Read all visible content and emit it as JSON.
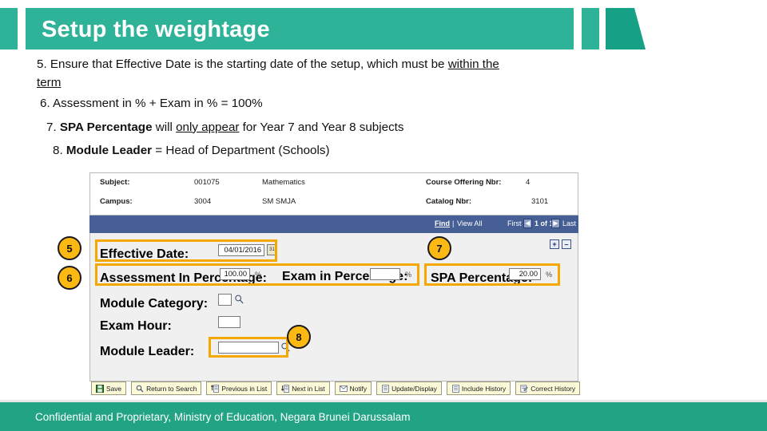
{
  "slide": {
    "title": "Setup the weightage",
    "accent_green": "#2eb398",
    "accent_green_dark": "#16a085",
    "footer_green": "#21a384",
    "highlight_orange": "#f5a800",
    "badge_yellow": "#fdb913",
    "nav_navy": "#465f95"
  },
  "bullets": [
    {
      "number": "5.",
      "parts": [
        {
          "text": " Ensure that Effective Date is the starting date of the setup, which must be ",
          "style": "normal"
        },
        {
          "text": "within the term",
          "style": "underline"
        }
      ],
      "plain": "5. Ensure that Effective Date is the starting date of the setup, which must be within the term"
    },
    {
      "number": "6.",
      "parts": [
        {
          "text": " Assessment in % + Exam in % = 100%",
          "style": "normal"
        }
      ],
      "plain": "6. Assessment in % + Exam in % = 100%"
    },
    {
      "number": "7.",
      "parts": [
        {
          "text": " SPA Percentage",
          "style": "bold"
        },
        {
          "text": " will ",
          "style": "normal"
        },
        {
          "text": "only appear",
          "style": "underline"
        },
        {
          "text": " for Year 7 and Year 8 subjects",
          "style": "normal"
        }
      ],
      "plain": "7. SPA Percentage will only appear for Year 7 and Year 8 subjects"
    },
    {
      "number": "8.",
      "parts": [
        {
          "text": " Module Leader",
          "style": "bold"
        },
        {
          "text": " = Head of Department (Schools)",
          "style": "normal"
        }
      ],
      "plain": "8. Module Leader = Head of Department (Schools)"
    }
  ],
  "bullet_text": {
    "b5_num": "5.",
    "b5_a": " Ensure that Effective Date is the starting date of the setup, which must be ",
    "b5_u": "within the",
    "b5_u2": "term",
    "b6_num": "6.",
    "b6_a": " Assessment in % + Exam in % = 100%",
    "b7_num": "7.",
    "b7_bold": " SPA Percentage",
    "b7_a": " will ",
    "b7_u": "only appear",
    "b7_b": " for Year 7 and Year 8 subjects",
    "b8_num": "8.",
    "b8_bold": " Module Leader",
    "b8_a": " = Head of Department (Schools)"
  },
  "app": {
    "header_fields": {
      "subject_label": "Subject:",
      "subject_code": "001075",
      "subject_name": "Mathematics",
      "course_offering_label": "Course Offering Nbr:",
      "course_offering_value": "4",
      "campus_label": "Campus:",
      "campus_code": "3004",
      "campus_name": "SM SMJA",
      "catalog_label": "Catalog Nbr:",
      "catalog_value": "3101"
    },
    "nav": {
      "find": "Find",
      "separator": "|",
      "view_all": "View All",
      "first": "First",
      "prev_arrow": "◀",
      "counter": "1 of 1",
      "next_arrow": "▶",
      "last": "Last"
    },
    "row_controls": {
      "add_row": "+",
      "delete_row": "–"
    },
    "form": {
      "effective_date_label": "Effective Date:",
      "effective_date_value": "04/01/2016",
      "calendar_icon": "calendar-icon",
      "assessment_label": "Assessment In Percentage:",
      "assessment_value": "100.00",
      "assessment_unit": "%",
      "exam_pct_label": "Exam in Percentage:",
      "exam_pct_value": "",
      "exam_pct_unit": "%",
      "spa_label": "SPA Percentage:",
      "spa_value": "20.00",
      "spa_unit": "%",
      "module_category_label": "Module Category:",
      "module_category_value": "",
      "exam_hour_label": "Exam Hour:",
      "exam_hour_value": "",
      "module_leader_label": "Module Leader:",
      "module_leader_value": ""
    },
    "toolbar": [
      {
        "label": "Save",
        "icon": "save-disk-icon"
      },
      {
        "label": "Return to Search",
        "icon": "magnifier-icon"
      },
      {
        "label": "Previous in List",
        "icon": "previous-list-icon"
      },
      {
        "label": "Next in List",
        "icon": "next-list-icon"
      },
      {
        "label": "Notify",
        "icon": "notify-envelope-icon"
      },
      {
        "label": "Update/Display",
        "icon": "update-display-icon"
      },
      {
        "label": "Include History",
        "icon": "include-history-icon"
      },
      {
        "label": "Correct History",
        "icon": "correct-history-icon"
      }
    ],
    "callouts": [
      {
        "number": "5",
        "target": "effective-date"
      },
      {
        "number": "6",
        "target": "assessment-percentage"
      },
      {
        "number": "7",
        "target": "spa-percentage"
      },
      {
        "number": "8",
        "target": "module-leader"
      }
    ]
  },
  "footer": {
    "text": "Confidential and Proprietary, Ministry of Education, Negara Brunei Darussalam"
  }
}
